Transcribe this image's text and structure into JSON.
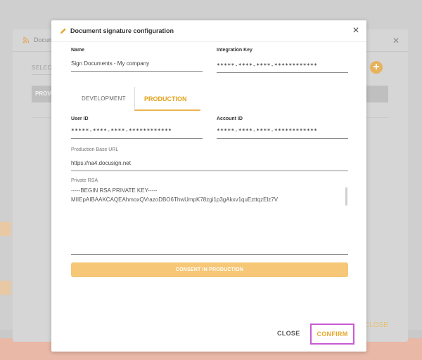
{
  "background": {
    "panel_title": "Docum",
    "select_label": "SELECT",
    "table_header_label": "PROV",
    "close_label": "CLOSE"
  },
  "modal": {
    "title": "Document signature configuration",
    "name_label": "Name",
    "name_value": "Sign Documents - My company",
    "integration_key_label": "Integration Key",
    "integration_key_value": "*****-****-****-************",
    "tabs": [
      {
        "label": "DEVELOPMENT",
        "active": false
      },
      {
        "label": "PRODUCTION",
        "active": true
      }
    ],
    "user_id_label": "User ID",
    "user_id_value": "*****-****-****-************",
    "account_id_label": "Account ID",
    "account_id_value": "*****-****-****-************",
    "base_url_label": "Production Base URL",
    "base_url_value": "https://na4.docusign.net",
    "private_rsa_label": "Private RSA",
    "private_rsa_lines": [
      "-----BEGIN RSA PRIVATE KEY-----",
      "MIIEpAIBAAKCAQEAhmoxQVrazoDBO6ThwUmpK78zgi1p3gAkxv1quEzttqzElz7V"
    ],
    "consent_button": "CONSENT IN PRODUCTION",
    "close_button": "CLOSE",
    "confirm_button": "CONFIRM"
  },
  "colors": {
    "accent": "#e6a728",
    "consent_bg": "#f6c777",
    "highlight_border": "#c95ad3"
  }
}
